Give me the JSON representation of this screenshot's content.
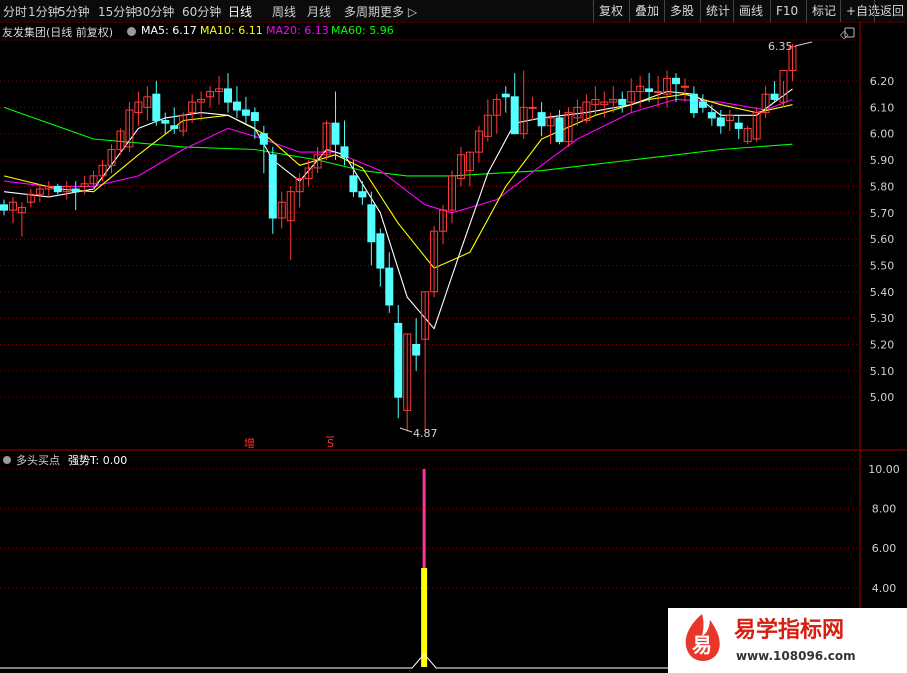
{
  "toolbar": {
    "periods": [
      {
        "label": "分时"
      },
      {
        "label": "1分钟"
      },
      {
        "label": "5分钟"
      },
      {
        "label": "15分钟"
      },
      {
        "label": "30分钟"
      },
      {
        "label": "60分钟"
      },
      {
        "label": "日线",
        "active": true
      },
      {
        "label": "周线"
      },
      {
        "label": "月线"
      },
      {
        "label": "多周期"
      },
      {
        "label": "更多 ▷"
      }
    ],
    "actions": [
      {
        "label": "复权"
      },
      {
        "label": "叠加"
      },
      {
        "label": "多股"
      },
      {
        "label": "统计"
      },
      {
        "label": "画线"
      },
      {
        "label": "F10"
      },
      {
        "label": "标记"
      },
      {
        "label": "+自选"
      },
      {
        "label": "返回"
      }
    ]
  },
  "header": {
    "title": "友发集团(日线 前复权)",
    "ma": [
      {
        "label": "MA5: 6.17",
        "color": "#ffffff"
      },
      {
        "label": "MA10: 6.11",
        "color": "#ffff00"
      },
      {
        "label": "MA20: 6.13",
        "color": "#ff00ff"
      },
      {
        "label": "MA60: 5.96",
        "color": "#00ff00"
      }
    ]
  },
  "price_axis": [
    "6.20",
    "6.10",
    "6.00",
    "5.90",
    "5.80",
    "5.70",
    "5.60",
    "5.50",
    "5.40",
    "5.30",
    "5.20",
    "5.10",
    "5.00"
  ],
  "annotations": {
    "high": "6.35",
    "low": "4.87"
  },
  "markers": {
    "zeng": "增",
    "s": "S"
  },
  "indicator": {
    "title": "多头买点",
    "value_label": "强势T: 0.00",
    "axis": [
      "10.00",
      "8.00",
      "6.00",
      "4.00"
    ]
  },
  "watermark": {
    "logo_char": "易",
    "name": "易学指标网",
    "url": "www.108096.com"
  },
  "colors": {
    "up": "#ff3b3b",
    "down": "#54ffff",
    "ma5": "#ffffff",
    "ma10": "#ffff00",
    "ma20": "#ff00ff",
    "ma60": "#00ff00",
    "grid": "#8b0000"
  },
  "chart_data": {
    "type": "candlestick",
    "ohlc": [
      [
        5.73,
        5.75,
        5.69,
        5.71
      ],
      [
        5.71,
        5.76,
        5.66,
        5.74
      ],
      [
        5.7,
        5.74,
        5.61,
        5.72
      ],
      [
        5.74,
        5.79,
        5.72,
        5.77
      ],
      [
        5.77,
        5.81,
        5.74,
        5.79
      ],
      [
        5.79,
        5.82,
        5.76,
        5.8
      ],
      [
        5.8,
        5.81,
        5.77,
        5.78
      ],
      [
        5.78,
        5.82,
        5.75,
        5.8
      ],
      [
        5.79,
        5.82,
        5.71,
        5.78
      ],
      [
        5.8,
        5.84,
        5.77,
        5.81
      ],
      [
        5.81,
        5.86,
        5.79,
        5.84
      ],
      [
        5.84,
        5.9,
        5.82,
        5.88
      ],
      [
        5.88,
        5.96,
        5.85,
        5.94
      ],
      [
        5.94,
        6.02,
        5.92,
        6.01
      ],
      [
        5.95,
        6.12,
        5.93,
        6.09
      ],
      [
        6.08,
        6.16,
        6.03,
        6.12
      ],
      [
        6.1,
        6.18,
        6.05,
        6.14
      ],
      [
        6.15,
        6.2,
        6.03,
        6.05
      ],
      [
        6.05,
        6.08,
        6.0,
        6.04
      ],
      [
        6.03,
        6.1,
        6.0,
        6.02
      ],
      [
        6.01,
        6.08,
        5.99,
        6.07
      ],
      [
        6.08,
        6.15,
        6.04,
        6.12
      ],
      [
        6.12,
        6.16,
        6.05,
        6.13
      ],
      [
        6.14,
        6.18,
        6.1,
        6.16
      ],
      [
        6.16,
        6.22,
        6.11,
        6.17
      ],
      [
        6.17,
        6.23,
        6.08,
        6.12
      ],
      [
        6.12,
        6.18,
        6.06,
        6.09
      ],
      [
        6.09,
        6.14,
        6.04,
        6.07
      ],
      [
        6.08,
        6.1,
        5.98,
        6.05
      ],
      [
        6.0,
        6.03,
        5.85,
        5.96
      ],
      [
        5.92,
        5.95,
        5.62,
        5.68
      ],
      [
        5.68,
        5.78,
        5.64,
        5.74
      ],
      [
        5.67,
        5.8,
        5.52,
        5.78
      ],
      [
        5.78,
        5.85,
        5.72,
        5.83
      ],
      [
        5.83,
        5.9,
        5.8,
        5.87
      ],
      [
        5.87,
        5.95,
        5.85,
        5.92
      ],
      [
        5.92,
        6.05,
        5.9,
        6.04
      ],
      [
        6.04,
        6.16,
        5.9,
        5.96
      ],
      [
        5.95,
        6.05,
        5.88,
        5.91
      ],
      [
        5.84,
        5.9,
        5.76,
        5.78
      ],
      [
        5.78,
        5.82,
        5.73,
        5.76
      ],
      [
        5.73,
        5.78,
        5.5,
        5.59
      ],
      [
        5.62,
        5.64,
        5.42,
        5.49
      ],
      [
        5.49,
        5.55,
        5.32,
        5.35
      ],
      [
        5.28,
        5.35,
        4.92,
        5.0
      ],
      [
        4.95,
        5.24,
        4.87,
        5.24
      ],
      [
        5.2,
        5.3,
        5.1,
        5.16
      ],
      [
        5.22,
        5.4,
        4.87,
        5.4
      ],
      [
        5.4,
        5.65,
        5.38,
        5.63
      ],
      [
        5.63,
        5.73,
        5.58,
        5.71
      ],
      [
        5.71,
        5.86,
        5.66,
        5.84
      ],
      [
        5.83,
        5.95,
        5.8,
        5.92
      ],
      [
        5.86,
        5.93,
        5.8,
        5.93
      ],
      [
        5.93,
        6.03,
        5.89,
        6.01
      ],
      [
        5.99,
        6.13,
        5.97,
        6.07
      ],
      [
        6.07,
        6.15,
        6.0,
        6.13
      ],
      [
        6.15,
        6.18,
        6.08,
        6.14
      ],
      [
        6.14,
        6.23,
        6.0,
        6.0
      ],
      [
        6.0,
        6.24,
        5.98,
        6.1
      ],
      [
        6.1,
        6.14,
        6.05,
        6.1
      ],
      [
        6.08,
        6.12,
        5.99,
        6.03
      ],
      [
        6.03,
        6.08,
        5.96,
        6.06
      ],
      [
        6.06,
        6.09,
        5.96,
        5.97
      ],
      [
        5.97,
        6.1,
        5.95,
        6.08
      ],
      [
        6.06,
        6.13,
        6.03,
        6.1
      ],
      [
        6.05,
        6.15,
        6.04,
        6.12
      ],
      [
        6.11,
        6.18,
        6.07,
        6.13
      ],
      [
        6.11,
        6.16,
        6.06,
        6.12
      ],
      [
        6.12,
        6.18,
        6.08,
        6.13
      ],
      [
        6.13,
        6.16,
        6.08,
        6.11
      ],
      [
        6.12,
        6.21,
        6.08,
        6.16
      ],
      [
        6.16,
        6.22,
        6.1,
        6.18
      ],
      [
        6.17,
        6.23,
        6.12,
        6.16
      ],
      [
        6.16,
        6.22,
        6.1,
        6.16
      ],
      [
        6.15,
        6.24,
        6.1,
        6.21
      ],
      [
        6.21,
        6.23,
        6.12,
        6.19
      ],
      [
        6.18,
        6.21,
        6.12,
        6.18
      ],
      [
        6.15,
        6.18,
        6.06,
        6.08
      ],
      [
        6.12,
        6.15,
        6.08,
        6.1
      ],
      [
        6.08,
        6.11,
        6.03,
        6.06
      ],
      [
        6.06,
        6.09,
        6.0,
        6.03
      ],
      [
        6.05,
        6.09,
        6.01,
        6.07
      ],
      [
        6.04,
        6.07,
        5.98,
        6.02
      ],
      [
        5.97,
        6.03,
        5.96,
        6.02
      ],
      [
        5.98,
        6.1,
        5.97,
        6.08
      ],
      [
        6.08,
        6.18,
        6.06,
        6.15
      ],
      [
        6.15,
        6.2,
        6.12,
        6.13
      ],
      [
        6.12,
        6.2,
        6.1,
        6.24
      ],
      [
        6.24,
        6.34,
        6.2,
        6.33
      ]
    ],
    "ma5": [
      [
        0,
        5.78
      ],
      [
        5,
        5.76
      ],
      [
        10,
        5.79
      ],
      [
        15,
        6.02
      ],
      [
        18,
        6.06
      ],
      [
        22,
        6.08
      ],
      [
        25,
        6.07
      ],
      [
        28,
        6.02
      ],
      [
        30,
        5.9
      ],
      [
        33,
        5.82
      ],
      [
        36,
        5.94
      ],
      [
        38,
        5.92
      ],
      [
        42,
        5.7
      ],
      [
        45,
        5.38
      ],
      [
        48,
        5.26
      ],
      [
        51,
        5.56
      ],
      [
        54,
        5.85
      ],
      [
        57,
        6.04
      ],
      [
        60,
        6.06
      ],
      [
        65,
        6.08
      ],
      [
        70,
        6.11
      ],
      [
        74,
        6.16
      ],
      [
        77,
        6.15
      ],
      [
        80,
        6.07
      ],
      [
        84,
        6.07
      ],
      [
        88,
        6.17
      ]
    ],
    "ma10": [
      [
        0,
        5.84
      ],
      [
        6,
        5.79
      ],
      [
        10,
        5.78
      ],
      [
        15,
        5.92
      ],
      [
        20,
        6.05
      ],
      [
        25,
        6.07
      ],
      [
        29,
        6.0
      ],
      [
        33,
        5.88
      ],
      [
        37,
        5.92
      ],
      [
        40,
        5.87
      ],
      [
        44,
        5.66
      ],
      [
        48,
        5.49
      ],
      [
        52,
        5.55
      ],
      [
        56,
        5.8
      ],
      [
        60,
        5.98
      ],
      [
        66,
        6.07
      ],
      [
        72,
        6.13
      ],
      [
        76,
        6.15
      ],
      [
        80,
        6.11
      ],
      [
        84,
        6.08
      ],
      [
        88,
        6.11
      ]
    ],
    "ma20": [
      [
        0,
        5.82
      ],
      [
        5,
        5.8
      ],
      [
        10,
        5.8
      ],
      [
        15,
        5.84
      ],
      [
        20,
        5.94
      ],
      [
        25,
        6.02
      ],
      [
        28,
        5.99
      ],
      [
        33,
        5.93
      ],
      [
        37,
        5.93
      ],
      [
        42,
        5.86
      ],
      [
        47,
        5.73
      ],
      [
        50,
        5.7
      ],
      [
        55,
        5.75
      ],
      [
        60,
        5.88
      ],
      [
        64,
        5.98
      ],
      [
        70,
        6.08
      ],
      [
        75,
        6.13
      ],
      [
        80,
        6.12
      ],
      [
        85,
        6.09
      ],
      [
        88,
        6.13
      ]
    ],
    "ma60": [
      [
        0,
        6.1
      ],
      [
        10,
        5.98
      ],
      [
        20,
        5.95
      ],
      [
        28,
        5.94
      ],
      [
        35,
        5.9
      ],
      [
        40,
        5.86
      ],
      [
        45,
        5.84
      ],
      [
        50,
        5.84
      ],
      [
        55,
        5.85
      ],
      [
        60,
        5.86
      ],
      [
        65,
        5.88
      ],
      [
        70,
        5.9
      ],
      [
        75,
        5.92
      ],
      [
        80,
        5.94
      ],
      [
        88,
        5.96
      ]
    ],
    "indicator": {
      "index": 47,
      "yellow": [
        0,
        5
      ],
      "magenta": [
        5,
        10
      ]
    }
  }
}
